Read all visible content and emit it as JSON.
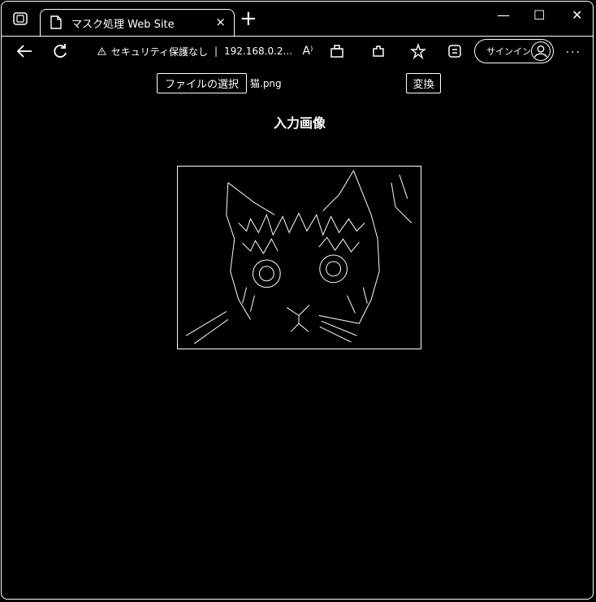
{
  "browser": {
    "tab_title": "マスク処理 Web Site",
    "tab_close": "×",
    "new_tab": "+",
    "window_controls": {
      "minimize": "—",
      "maximize": "☐",
      "close": "✕"
    },
    "security_label": "セキュリティ保護なし",
    "address": "192.168.0.2...",
    "signin_label": "サインイン",
    "more": "···",
    "icons": [
      "tab-actions-icon",
      "page-icon",
      "back-icon",
      "refresh-icon",
      "warning-icon",
      "read-aloud-icon",
      "app-icon",
      "extensions-icon",
      "favorites-icon",
      "collections-icon",
      "profile-icon"
    ]
  },
  "page": {
    "file_button": "ファイルの選択",
    "file_name": "猫.png",
    "convert_button": "変換",
    "heading": "入力画像"
  }
}
